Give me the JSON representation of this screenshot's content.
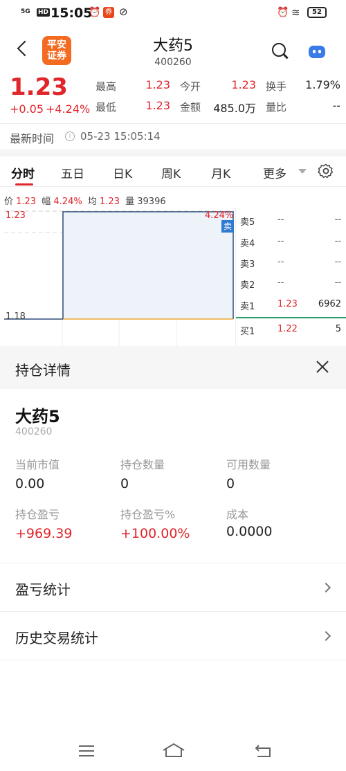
{
  "status_bar": {
    "network": "5G",
    "hd": "HD",
    "time": "15:05",
    "battery": "52"
  },
  "header": {
    "logo_line1": "平安",
    "logo_line2": "证券",
    "stock_name": "大药5",
    "stock_code": "400260"
  },
  "quote": {
    "price": "1.23",
    "change": "+0.05",
    "change_pct": "+4.24%",
    "stats": [
      {
        "label": "最高",
        "value": "1.23"
      },
      {
        "label": "今开",
        "value": "1.23"
      },
      {
        "label": "换手",
        "value": "1.79%"
      },
      {
        "label": "最低",
        "value": "1.23"
      },
      {
        "label": "金额",
        "value": "485.0万"
      },
      {
        "label": "量比",
        "value": "--"
      }
    ],
    "time_label": "最新时间",
    "time_value": "05-23 15:05:14"
  },
  "tabs": [
    "分时",
    "五日",
    "日K",
    "周K",
    "月K",
    "更多"
  ],
  "info_line": {
    "price_label": "价",
    "price": "1.23",
    "amp_label": "幅",
    "amp": "4.24%",
    "avg_label": "均",
    "avg": "1.23",
    "vol_label": "量",
    "vol": "39396"
  },
  "chart": {
    "y_top": "1.23",
    "y_bottom": "1.18",
    "pct_top": "4.24%",
    "sell_badge": "卖"
  },
  "order_book": [
    {
      "label": "卖5",
      "price": "--",
      "vol": "--"
    },
    {
      "label": "卖4",
      "price": "--",
      "vol": "--"
    },
    {
      "label": "卖3",
      "price": "--",
      "vol": "--"
    },
    {
      "label": "卖2",
      "price": "--",
      "vol": "--"
    },
    {
      "label": "卖1",
      "price": "1.23",
      "vol": "6962"
    },
    {
      "label": "买1",
      "price": "1.22",
      "vol": "5"
    }
  ],
  "sheet": {
    "title": "持仓详情",
    "stock_name": "大药5",
    "stock_code": "400260",
    "fields": [
      {
        "label": "当前市值",
        "value": "0.00"
      },
      {
        "label": "持仓数量",
        "value": "0"
      },
      {
        "label": "可用数量",
        "value": "0"
      },
      {
        "label": "持仓盈亏",
        "value": "+969.39"
      },
      {
        "label": "持仓盈亏%",
        "value": "+100.00%"
      },
      {
        "label": "成本",
        "value": "0.0000"
      }
    ],
    "menu": [
      "盈亏统计",
      "历史交易统计"
    ]
  }
}
